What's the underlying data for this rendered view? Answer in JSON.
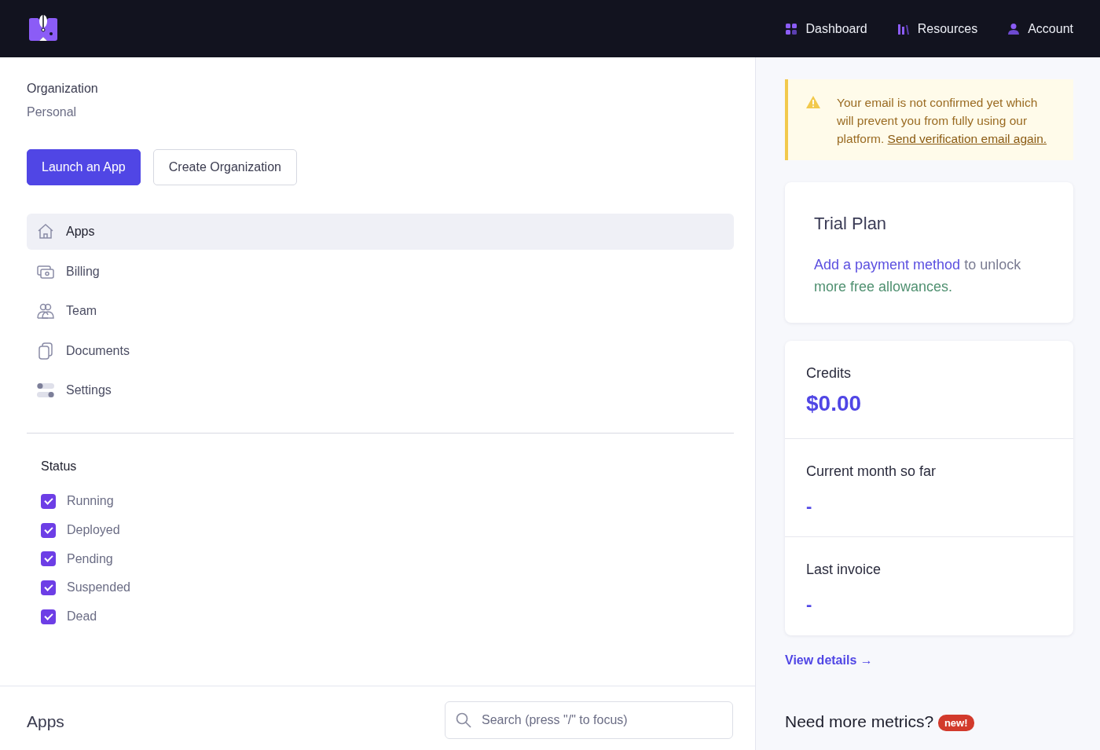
{
  "nav": {
    "links": [
      {
        "label": "Dashboard",
        "kind": "grid"
      },
      {
        "label": "Resources",
        "kind": "books"
      },
      {
        "label": "Account",
        "kind": "user"
      }
    ]
  },
  "organization": {
    "label": "Organization",
    "value": "Personal"
  },
  "buttons": [
    {
      "label": "Launch an App",
      "kind": "primary"
    },
    {
      "label": "Create Organization",
      "kind": "outline"
    }
  ],
  "sidebar": {
    "items": [
      {
        "label": "Apps",
        "kind": "home",
        "selected": true
      },
      {
        "label": "Billing",
        "kind": "billing",
        "selected": false
      },
      {
        "label": "Team",
        "kind": "team",
        "selected": false
      },
      {
        "label": "Documents",
        "kind": "documents",
        "selected": false
      },
      {
        "label": "Settings",
        "kind": "settings",
        "selected": false
      }
    ]
  },
  "status": {
    "title": "Status",
    "options": [
      {
        "label": "Running",
        "checked": true
      },
      {
        "label": "Deployed",
        "checked": true
      },
      {
        "label": "Pending",
        "checked": true
      },
      {
        "label": "Suspended",
        "checked": true
      },
      {
        "label": "Dead",
        "checked": true
      }
    ]
  },
  "apps": {
    "title": "Apps",
    "search": {
      "placeholder": "Search (press \"/\" to focus)"
    }
  },
  "alert": {
    "text": "Your email is not confirmed yet which will prevent you from fully using our platform.",
    "link": "Send verification email again."
  },
  "plan": {
    "title": "Trial Plan",
    "segments": [
      {
        "text": "Add a payment method",
        "kind": "link"
      },
      {
        "text": "to unlock",
        "kind": "plain"
      },
      {
        "text": "more free allowances.",
        "kind": "highlight"
      }
    ]
  },
  "billing": {
    "sections": [
      {
        "label": "Credits",
        "value": "$0.00",
        "kind": "amount"
      },
      {
        "label": "Current month so far",
        "value": "-",
        "kind": "dash"
      },
      {
        "label": "Last invoice",
        "value": "-",
        "kind": "dash"
      }
    ]
  },
  "view_details": "View details →",
  "metrics": {
    "title": "Need more metrics?",
    "badge": "new!"
  }
}
